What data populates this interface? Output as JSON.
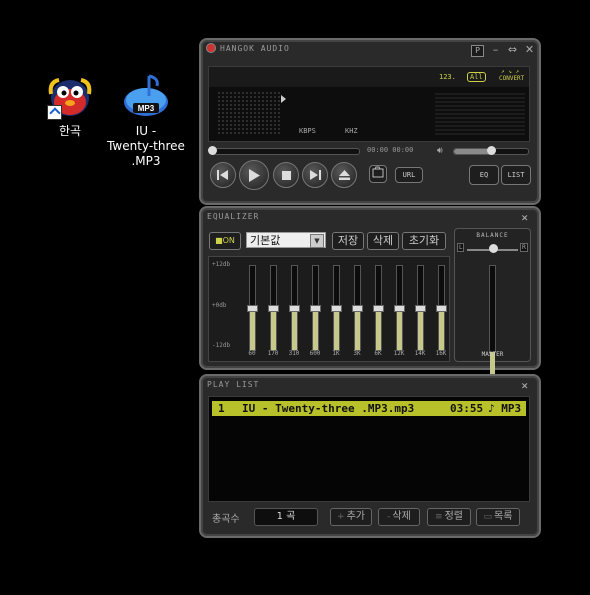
{
  "desktop": {
    "icons": [
      {
        "label": "한곡"
      },
      {
        "label_lines": [
          "IU -",
          "Twenty-three",
          ".MP3"
        ]
      }
    ],
    "mp3_badge": "MP3"
  },
  "player": {
    "title": "HANGOK AUDIO",
    "window_buttons": {
      "pin": "P",
      "minimize": "–",
      "restore": "⇔",
      "close": "✕"
    },
    "badges": {
      "track_no": "123.",
      "mode": "All",
      "convert_top": "↗ ↘ ↗",
      "convert": "CONVERT"
    },
    "kbps_label": "KBPS",
    "khz_label": "KHZ",
    "time": "00:00 00:00",
    "seek_fraction": 0.0,
    "volume_fraction": 0.5,
    "url_label": "URL",
    "eq_label": "EQ",
    "list_label": "LIST"
  },
  "equalizer": {
    "title": "EQUALIZER",
    "on_label": "■ON",
    "preset": "기본값",
    "save_label": "저장",
    "delete_label": "삭제",
    "reset_label": "초기화",
    "db_top": "+12db",
    "db_mid": "+0db",
    "db_bottom": "-12db",
    "bands": [
      {
        "label": "60",
        "gain_db": 0
      },
      {
        "label": "170",
        "gain_db": 0
      },
      {
        "label": "310",
        "gain_db": 0
      },
      {
        "label": "600",
        "gain_db": 0
      },
      {
        "label": "1K",
        "gain_db": 0
      },
      {
        "label": "3K",
        "gain_db": 0
      },
      {
        "label": "6K",
        "gain_db": 0
      },
      {
        "label": "12K",
        "gain_db": 0
      },
      {
        "label": "14K",
        "gain_db": 0
      },
      {
        "label": "16K",
        "gain_db": 0
      }
    ],
    "balance_label": "BALANCE",
    "balance_left": "L",
    "balance_right": "R",
    "balance_value": 0.0,
    "master_label": "MASTER",
    "master_fraction": 0.0
  },
  "playlist": {
    "title": "PLAY LIST",
    "rows": [
      {
        "index": "1",
        "name": "IU - Twenty-three .MP3.mp3",
        "duration": "03:55",
        "type": "♪ MP3"
      }
    ],
    "count_label": "총곡수",
    "count_value": "1 곡",
    "add_label": "추가",
    "delete_label": "삭제",
    "sort_label": "정렬",
    "list_label": "목록"
  },
  "colors": {
    "accent": "#cdd04a",
    "selected_row": "#b9c12a",
    "panel": "#2a2a2a"
  }
}
